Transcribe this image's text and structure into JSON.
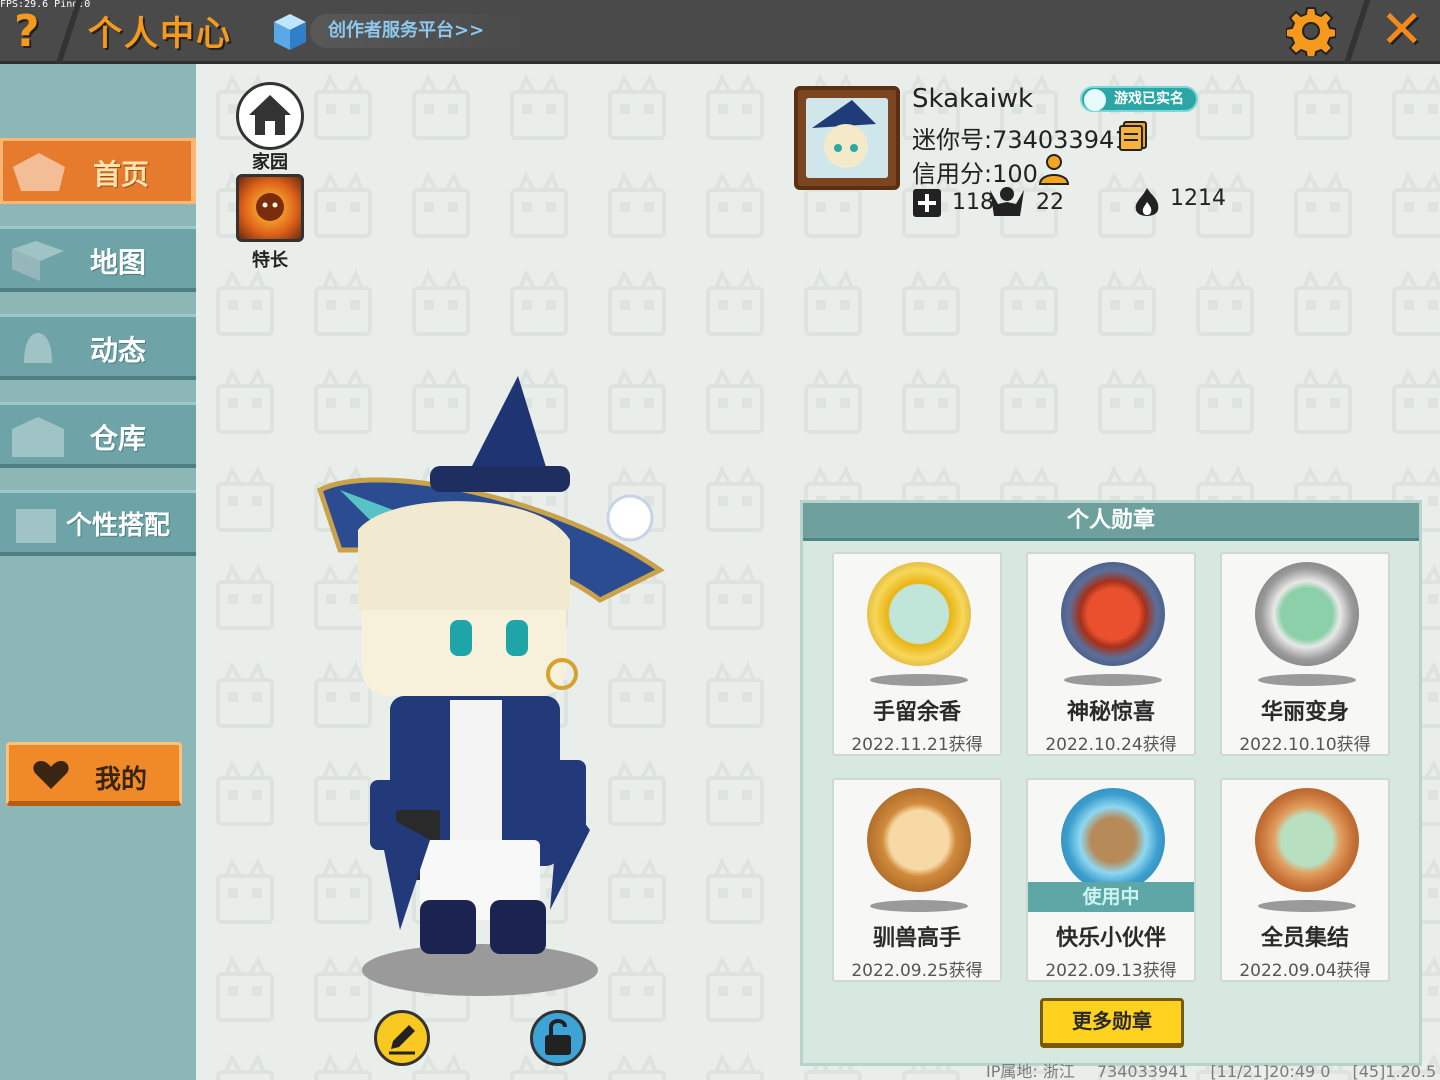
{
  "top_bar": {
    "fps_text": "FPS:29.6 Ping:0",
    "help_icon": "question-mark-icon",
    "title": "个人中心",
    "creator_link": "创作者服务平台>>",
    "settings_icon": "gear-icon",
    "close_icon": "close-x-icon",
    "accent_color": "#f59a1c"
  },
  "sidebar": {
    "items": [
      {
        "label": "首页",
        "icon": "home-blocks-icon",
        "active": true
      },
      {
        "label": "地图",
        "icon": "map-icon",
        "active": false
      },
      {
        "label": "动态",
        "icon": "bell-icon",
        "active": false
      },
      {
        "label": "仓库",
        "icon": "warehouse-icon",
        "active": false
      },
      {
        "label": "个性搭配",
        "icon": "outfit-icon",
        "active": false
      }
    ],
    "mine_label": "我的",
    "mine_icon": "heart-icon"
  },
  "quick_links": [
    {
      "label": "家园",
      "icon": "home-icon"
    },
    {
      "label": "特长",
      "icon": "flame-character-icon"
    }
  ],
  "profile": {
    "username": "Skakaiwk",
    "verified_badge": "游戏已实名",
    "uid_text": "迷你号:734033941",
    "credit_text": "信用分:100",
    "stats": [
      {
        "icon": "plus-icon",
        "value": "118"
      },
      {
        "icon": "fans-icon",
        "value": "22"
      },
      {
        "icon": "fire-icon",
        "value": "1214"
      }
    ]
  },
  "character_tools": [
    {
      "icon": "pencil-icon"
    },
    {
      "icon": "unlock-icon"
    }
  ],
  "medals": {
    "title": "个人勋章",
    "items": [
      {
        "name": "手留余香",
        "date": "2022.11.21获得",
        "color": "#e9b413",
        "using": false
      },
      {
        "name": "神秘惊喜",
        "date": "2022.10.24获得",
        "color": "#5b6f9a",
        "using": false
      },
      {
        "name": "华丽变身",
        "date": "2022.10.10获得",
        "color": "#9a9a9a",
        "using": false
      },
      {
        "name": "驯兽高手",
        "date": "2022.09.25获得",
        "color": "#d08a3a",
        "using": false
      },
      {
        "name": "快乐小伙伴",
        "date": "2022.09.13获得",
        "color": "#3d9fcf",
        "using": true,
        "using_label": "使用中"
      },
      {
        "name": "全员集结",
        "date": "2022.09.04获得",
        "color": "#c9743a",
        "using": false
      }
    ],
    "more_button": "更多勋章"
  },
  "footer": {
    "ip_text": "IP属地: 浙江",
    "uid": "734033941",
    "timestamp": "[11/21]20:49 0",
    "version": "[45]1.20.5"
  }
}
